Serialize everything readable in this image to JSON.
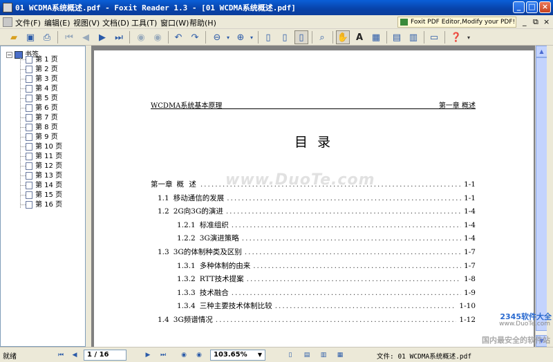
{
  "window": {
    "title": "01 WCDMA系统概述.pdf - Foxit Reader 1.3 - [01 WCDMA系统概述.pdf]",
    "min_label": "_",
    "max_label": "□",
    "close_label": "×"
  },
  "menu": {
    "items": [
      "文件(F)",
      "编辑(E)",
      "视图(V)",
      "文档(D)",
      "工具(T)",
      "窗口(W)",
      "帮助(H)"
    ],
    "promo": "Foxit PDF Editor,Modify your PDF!",
    "doc_min": "_",
    "doc_restore": "⧉",
    "doc_close": "×"
  },
  "sidebar": {
    "root_label": "书签",
    "root_toggle": "−",
    "items": [
      "第 1 页",
      "第 2 页",
      "第 3 页",
      "第 4 页",
      "第 5 页",
      "第 6 页",
      "第 7 页",
      "第 8 页",
      "第 9 页",
      "第 10 页",
      "第 11 页",
      "第 12 页",
      "第 13 页",
      "第 14 页",
      "第 15 页",
      "第 16 页"
    ]
  },
  "page": {
    "header_left": "WCDMA系统基本原理",
    "header_right": "第一章 概述",
    "title": "目 录",
    "watermark": "www.DuoTe.com",
    "toc": [
      {
        "num": "第一章",
        "title": "概 述",
        "page": "1-1",
        "level": 0
      },
      {
        "num": "1.1",
        "title": "移动通信的发展",
        "page": "1-1",
        "level": 1
      },
      {
        "num": "1.2",
        "title": "2G向3G的演进",
        "page": "1-4",
        "level": 1
      },
      {
        "num": "1.2.1",
        "title": "标准组织",
        "page": "1-4",
        "level": 2
      },
      {
        "num": "1.2.2",
        "title": "3G演进策略",
        "page": "1-4",
        "level": 2
      },
      {
        "num": "1.3",
        "title": "3G的体制种类及区别",
        "page": "1-7",
        "level": 1
      },
      {
        "num": "1.3.1",
        "title": "多种体制的由来",
        "page": "1-7",
        "level": 2
      },
      {
        "num": "1.3.2",
        "title": "RTT技术提案",
        "page": "1-8",
        "level": 2
      },
      {
        "num": "1.3.3",
        "title": "技术融合",
        "page": "1-9",
        "level": 2
      },
      {
        "num": "1.3.4",
        "title": "三种主要技术体制比较",
        "page": "1-10",
        "level": 2
      },
      {
        "num": "1.4",
        "title": "3G频谱情况",
        "page": "1-12",
        "level": 1
      }
    ]
  },
  "status": {
    "ready": "就绪",
    "page_indicator": "1 / 16",
    "zoom": "103.65%",
    "file": "文件: 01 WCDMA系统概述.pdf"
  },
  "badge": {
    "top": "2345软件大全",
    "url": "www.DuoTe.com",
    "sub": "国内最安全的软件站"
  },
  "colors": {
    "titlebar": "#0842a8",
    "chrome": "#ece9d8",
    "doc_bg": "#808080"
  }
}
